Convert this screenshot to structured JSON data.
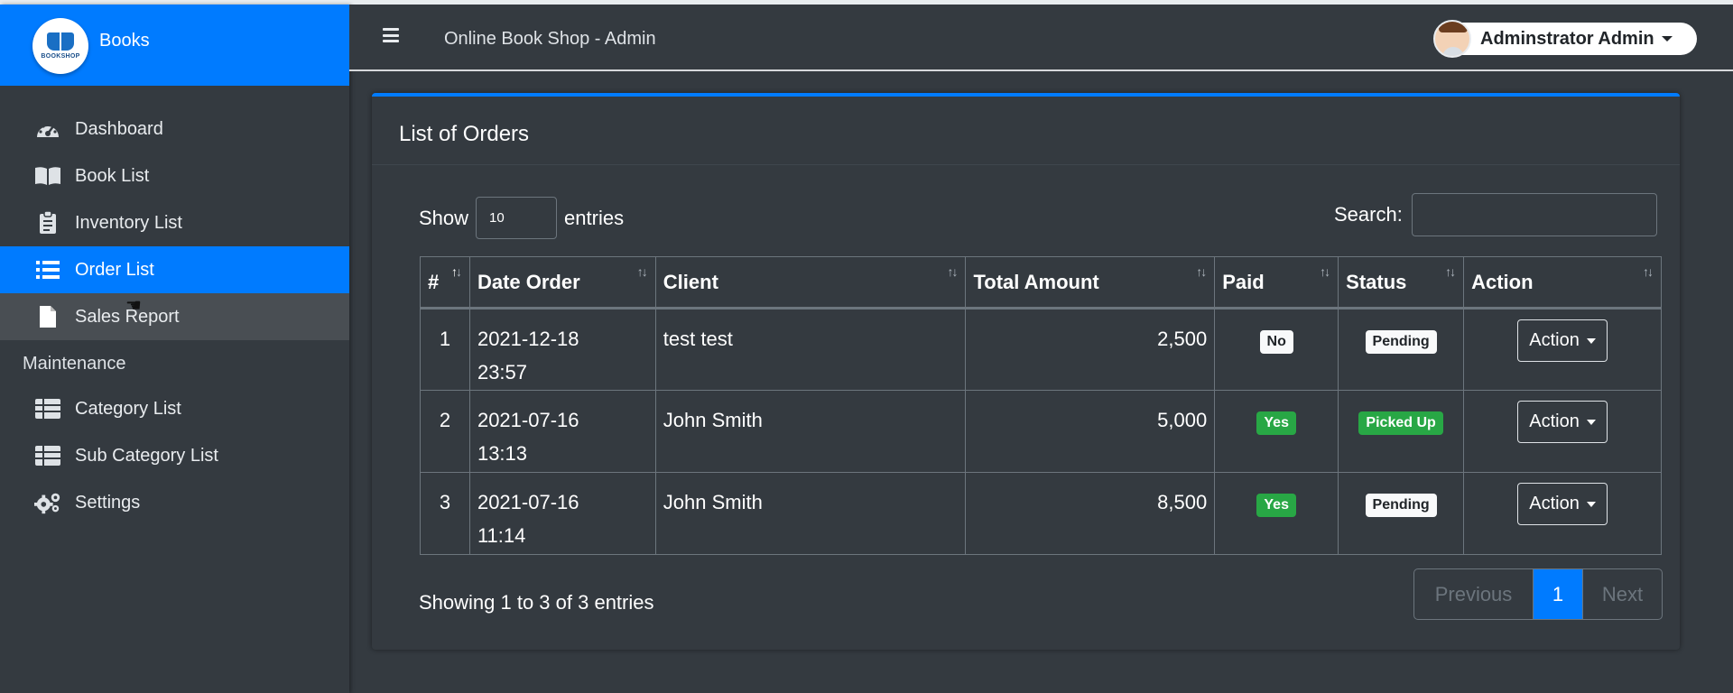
{
  "brand": {
    "title": "Books",
    "logo_text": "BOOKSHOP"
  },
  "topbar": {
    "title": "Online Book Shop - Admin",
    "user": "Adminstrator Admin"
  },
  "sidebar": {
    "items": [
      {
        "label": "Dashboard",
        "icon": "dashboard-icon"
      },
      {
        "label": "Book List",
        "icon": "book-icon"
      },
      {
        "label": "Inventory List",
        "icon": "clipboard-icon"
      },
      {
        "label": "Order List",
        "icon": "list-icon",
        "active": true
      },
      {
        "label": "Sales Report",
        "icon": "file-icon",
        "hover": true
      }
    ],
    "section_header": "Maintenance",
    "maintenance_items": [
      {
        "label": "Category List",
        "icon": "table-icon"
      },
      {
        "label": "Sub Category List",
        "icon": "table-icon"
      },
      {
        "label": "Settings",
        "icon": "gears-icon"
      }
    ]
  },
  "card": {
    "title": "List of Orders"
  },
  "datatable": {
    "show_label": "Show",
    "entries_label": "entries",
    "length_value": "10",
    "search_label": "Search:",
    "search_value": "",
    "info": "Showing 1 to 3 of 3 entries",
    "columns": [
      "#",
      "Date Order",
      "Client",
      "Total Amount",
      "Paid",
      "Status",
      "Action"
    ],
    "rows": [
      {
        "num": "1",
        "date": "2021-12-18",
        "time": "23:57",
        "client": "test test",
        "amount": "2,500",
        "paid": "No",
        "status": "Pending",
        "action": "Action"
      },
      {
        "num": "2",
        "date": "2021-07-16",
        "time": "13:13",
        "client": "John Smith",
        "amount": "5,000",
        "paid": "Yes",
        "status": "Picked Up",
        "action": "Action"
      },
      {
        "num": "3",
        "date": "2021-07-16",
        "time": "11:14",
        "client": "John Smith",
        "amount": "8,500",
        "paid": "Yes",
        "status": "Pending",
        "action": "Action"
      }
    ],
    "pagination": {
      "previous": "Previous",
      "current": "1",
      "next": "Next"
    }
  },
  "colors": {
    "primary": "#007bff",
    "success": "#28a745",
    "background": "#343a40"
  }
}
